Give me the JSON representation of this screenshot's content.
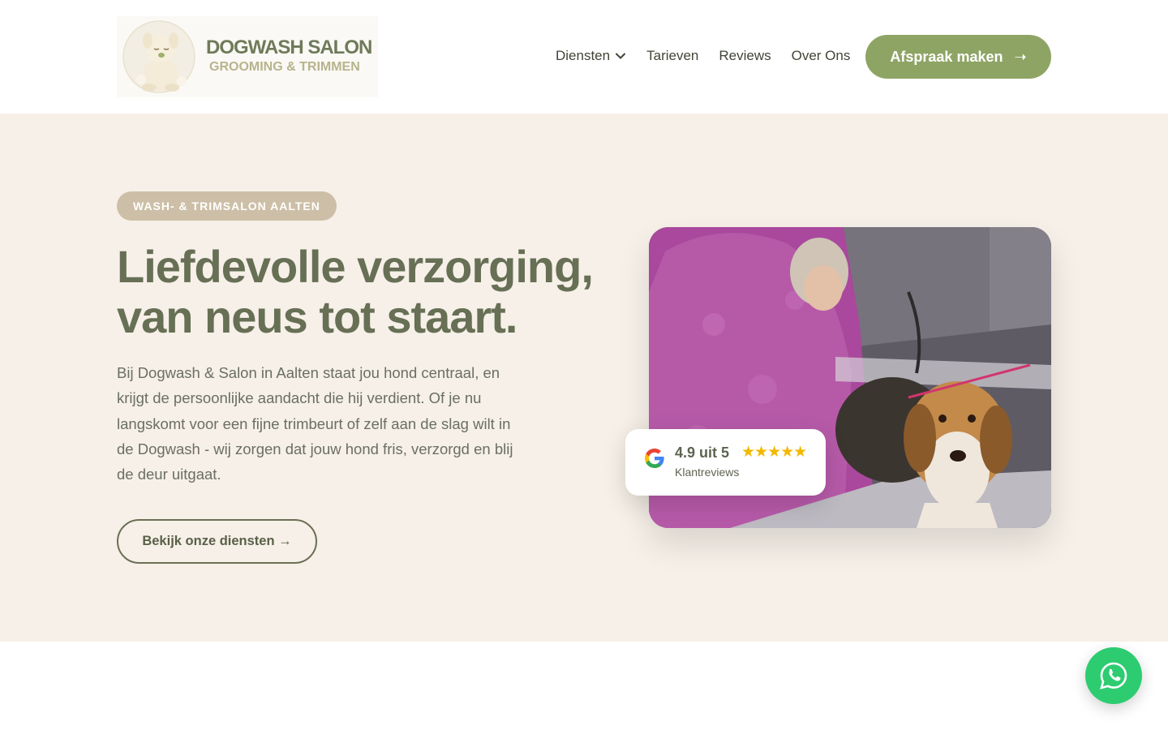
{
  "header": {
    "logo": {
      "title": "DOGWASH SALON",
      "subtitle": "GROOMING & TRIMMEN"
    },
    "nav": [
      {
        "label": "Diensten",
        "has_dropdown": true,
        "icon": "chevron-down-icon"
      },
      {
        "label": "Tarieven"
      },
      {
        "label": "Reviews"
      },
      {
        "label": "Over Ons"
      }
    ],
    "cta": {
      "label": "Afspraak maken",
      "icon": "arrow-right-icon"
    }
  },
  "hero": {
    "badge": "WASH- & TRIMSALON AALTEN",
    "headline_line1": "Liefdevolle verzorging,",
    "headline_line2": "van neus tot staart.",
    "intro": "Bij Dogwash & Salon in Aalten staat jou hond centraal, en krijgt de persoonlijke aandacht die hij verdient. Of je nu langskomt voor een fijne trimbeurt of zelf aan de slag wilt in de Dogwash - wij zorgen dat jouw hond fris, verzorgd en blij de deur uitgaat.",
    "button": "Bekijk onze diensten →",
    "review": {
      "source_icon": "google-icon",
      "rating": "4.9 uit 5",
      "stars": "★★★★★",
      "label": "Klantreviews"
    }
  },
  "floating": {
    "whatsapp_icon": "whatsapp-icon"
  },
  "colors": {
    "accent": "#8ea464",
    "hero_bg": "#f6f0e8",
    "badge_bg": "#cdbfa7",
    "headline": "#676f55",
    "star": "#f2b900",
    "whatsapp": "#2ecc71"
  }
}
